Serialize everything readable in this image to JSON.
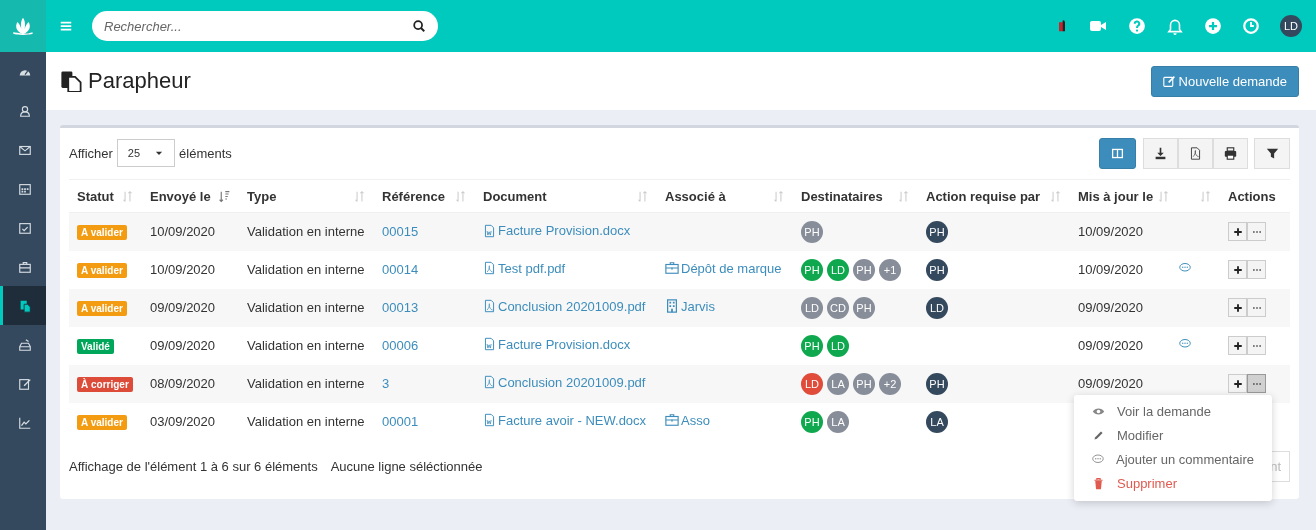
{
  "sidebar": {
    "items": [
      {
        "selected": false
      },
      {
        "selected": false
      },
      {
        "selected": false
      },
      {
        "selected": false
      },
      {
        "selected": false
      },
      {
        "selected": false
      },
      {
        "selected": true
      },
      {
        "selected": false
      },
      {
        "selected": false
      },
      {
        "selected": false
      }
    ]
  },
  "topbar": {
    "search": {
      "placeholder": "Rechercher..."
    },
    "user": {
      "initials": "LD"
    }
  },
  "page": {
    "title": "Parapheur",
    "new_button": "Nouvelle demande"
  },
  "table_controls": {
    "show_label": "Afficher",
    "page_size": "25",
    "show_suffix": "éléments",
    "tools": [
      {
        "kind": "columns",
        "selected": true
      },
      {
        "kind": "download",
        "selected": false
      },
      {
        "kind": "pdf",
        "selected": false
      },
      {
        "kind": "print",
        "selected": false
      },
      {
        "kind": "filter",
        "selected": false
      }
    ]
  },
  "table": {
    "columns": [
      {
        "label": "Statut",
        "kind": "sortable"
      },
      {
        "label": "Envoyé le",
        "kind": "sorted"
      },
      {
        "label": "Type",
        "kind": "sortable"
      },
      {
        "label": "Référence",
        "kind": "sortable"
      },
      {
        "label": "Document",
        "kind": "sortable"
      },
      {
        "label": "Associé à",
        "kind": "sortable"
      },
      {
        "label": "Destinataires",
        "kind": "sortable"
      },
      {
        "label": "Action requise par",
        "kind": "sortable"
      },
      {
        "label": "Mis à jour le",
        "kind": "sortable"
      },
      {
        "kind": "sortable"
      },
      {
        "label": "Actions",
        "kind": "plain"
      }
    ],
    "rows": [
      {
        "status": {
          "label": "A valider",
          "kind": "pending"
        },
        "sent": "10/09/2020",
        "type": "Validation en interne",
        "reference": "00015",
        "document": {
          "name": "Facture Provision.docx",
          "kind": "word"
        },
        "recipients": [
          {
            "initials": "PH",
            "kind": "waiting"
          }
        ],
        "action_by": "PH",
        "updated": "10/09/2020",
        "comment": false,
        "actions": {
          "menu_open": false
        }
      },
      {
        "status": {
          "label": "A valider",
          "kind": "pending"
        },
        "sent": "10/09/2020",
        "type": "Validation en interne",
        "reference": "00014",
        "document": {
          "name": "Test pdf.pdf",
          "kind": "pdf"
        },
        "associated": {
          "name": "Dépôt de marque",
          "kind": "case"
        },
        "recipients": [
          {
            "initials": "PH",
            "kind": "approved"
          },
          {
            "initials": "LD",
            "kind": "approved"
          },
          {
            "initials": "PH",
            "kind": "waiting"
          },
          {
            "initials": "+1",
            "kind": "waiting"
          }
        ],
        "action_by": "PH",
        "updated": "10/09/2020",
        "comment": true,
        "actions": {
          "menu_open": false
        }
      },
      {
        "status": {
          "label": "A valider",
          "kind": "pending"
        },
        "sent": "09/09/2020",
        "type": "Validation en interne",
        "reference": "00013",
        "document": {
          "name": "Conclusion 20201009.pdf",
          "kind": "pdf"
        },
        "associated": {
          "name": "Jarvis",
          "kind": "company"
        },
        "recipients": [
          {
            "initials": "LD",
            "kind": "waiting"
          },
          {
            "initials": "CD",
            "kind": "waiting"
          },
          {
            "initials": "PH",
            "kind": "waiting"
          }
        ],
        "action_by": "LD",
        "updated": "09/09/2020",
        "comment": false,
        "actions": {
          "menu_open": false
        }
      },
      {
        "status": {
          "label": "Validé",
          "kind": "done"
        },
        "sent": "09/09/2020",
        "type": "Validation en interne",
        "reference": "00006",
        "document": {
          "name": "Facture Provision.docx",
          "kind": "word"
        },
        "recipients": [
          {
            "initials": "PH",
            "kind": "approved"
          },
          {
            "initials": "LD",
            "kind": "approved"
          }
        ],
        "updated": "09/09/2020",
        "comment": true,
        "actions": {
          "menu_open": false
        }
      },
      {
        "status": {
          "label": "À corriger",
          "kind": "rejected"
        },
        "sent": "08/09/2020",
        "type": "Validation en interne",
        "reference": "3",
        "document": {
          "name": "Conclusion 20201009.pdf",
          "kind": "pdf"
        },
        "recipients": [
          {
            "initials": "LD",
            "kind": "rejected"
          },
          {
            "initials": "LA",
            "kind": "waiting"
          },
          {
            "initials": "PH",
            "kind": "waiting"
          },
          {
            "initials": "+2",
            "kind": "waiting"
          }
        ],
        "action_by": "PH",
        "updated": "09/09/2020",
        "comment": false,
        "actions": {
          "menu_open": true
        }
      },
      {
        "status": {
          "label": "A valider",
          "kind": "pending"
        },
        "sent": "03/09/2020",
        "type": "Validation en interne",
        "reference": "00001",
        "document": {
          "name": "Facture avoir - NEW.docx",
          "kind": "word"
        },
        "associated": {
          "name": "Asso",
          "kind": "case"
        },
        "recipients": [
          {
            "initials": "PH",
            "kind": "approved"
          },
          {
            "initials": "LA",
            "kind": "waiting"
          }
        ],
        "action_by": "LA",
        "comment": false
      }
    ]
  },
  "footer": {
    "info": "Affichage de l'élément 1 à 6 sur 6 éléments",
    "selection": "Aucune ligne séléctionnée",
    "pagination_button": "nt"
  },
  "action_menu": {
    "items": [
      {
        "label": "Voir la demande",
        "kind": "view",
        "danger": false
      },
      {
        "label": "Modifier",
        "kind": "edit",
        "danger": false
      },
      {
        "label": "Ajouter un commentaire",
        "kind": "comment",
        "danger": false
      },
      {
        "label": "Supprimer",
        "kind": "delete",
        "danger": true
      }
    ]
  }
}
